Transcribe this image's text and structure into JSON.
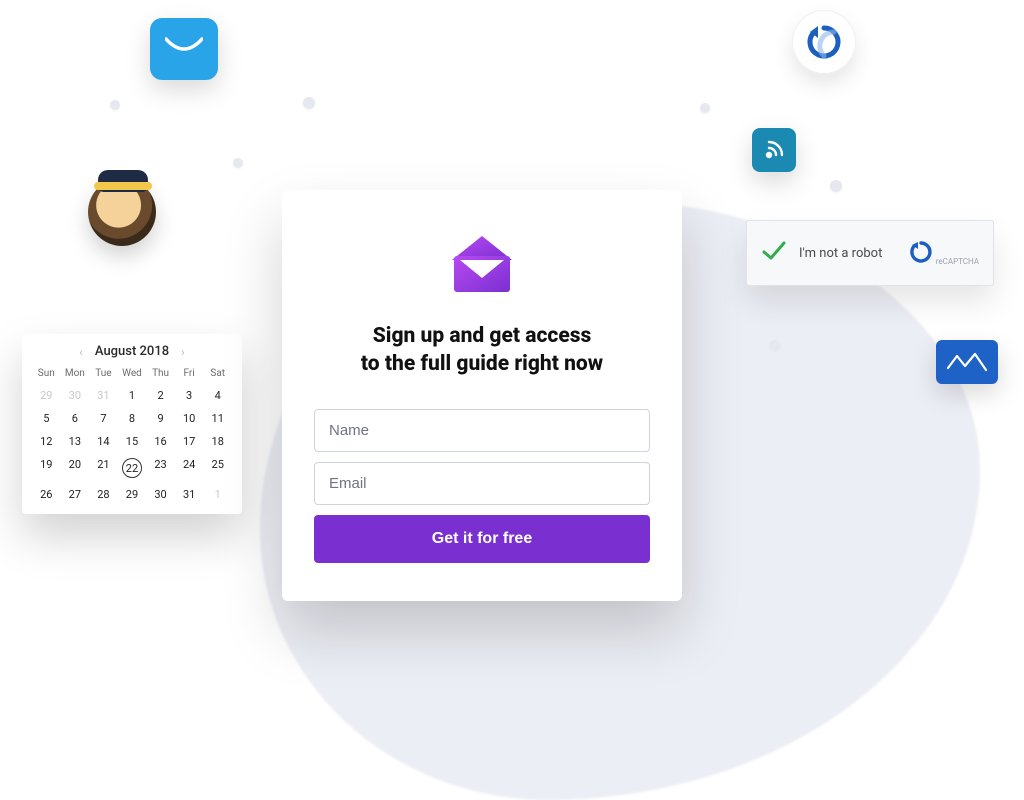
{
  "signup": {
    "heading_line1": "Sign up and get access",
    "heading_line2": "to the full guide right now",
    "name_placeholder": "Name",
    "email_placeholder": "Email",
    "cta_label": "Get it for free"
  },
  "recaptcha": {
    "label": "I'm not a robot",
    "brand": "reCAPTCHA"
  },
  "calendar": {
    "title": "August 2018",
    "prev": "‹",
    "next": "›",
    "dow": [
      "Sun",
      "Mon",
      "Tue",
      "Wed",
      "Thu",
      "Fri",
      "Sat"
    ],
    "leading_muted": [
      29,
      30,
      31
    ],
    "month_days": [
      1,
      2,
      3,
      4,
      5,
      6,
      7,
      8,
      9,
      10,
      11,
      12,
      13,
      14,
      15,
      16,
      17,
      18,
      19,
      20,
      21,
      22,
      23,
      24,
      25,
      26,
      27,
      28,
      29,
      30,
      31
    ],
    "trailing_muted": [
      1
    ],
    "selected_day": 22
  },
  "icons": {
    "smile_mail": "smile-mail-icon",
    "refresh": "refresh-icon",
    "signal": "signal-icon",
    "blue_mail": "blue-mail-icon",
    "envelope": "envelope-icon",
    "mailchimp": "mailchimp-icon",
    "check": "check-icon",
    "recaptcha_badge": "recaptcha-badge-icon"
  },
  "colors": {
    "accent": "#7a2fd1",
    "blob": "#eceef5"
  }
}
